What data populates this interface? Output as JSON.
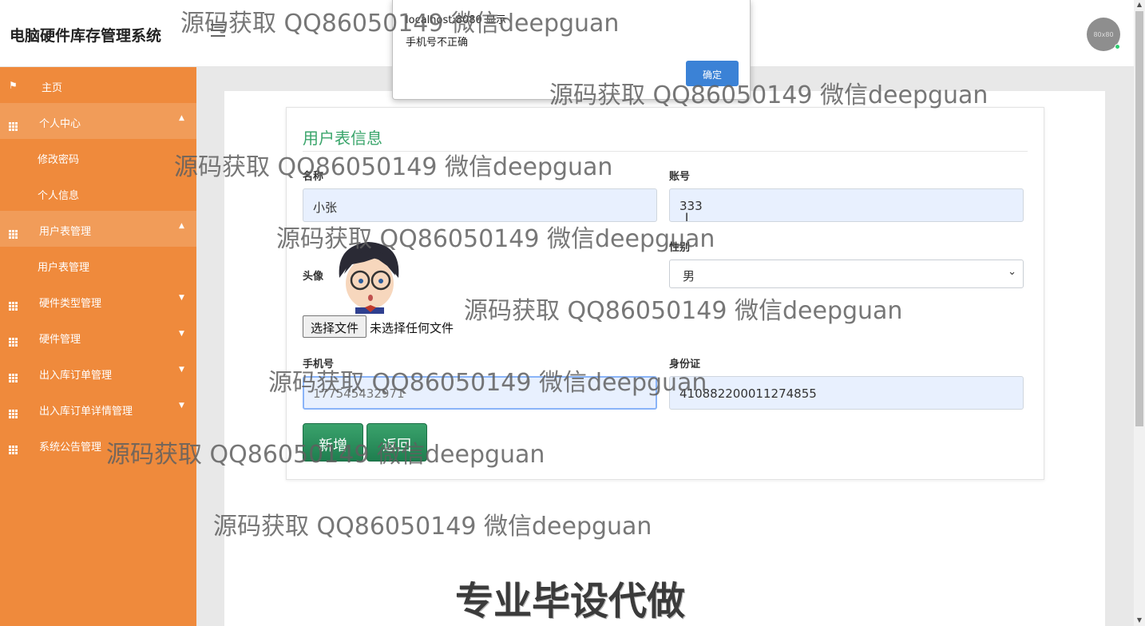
{
  "header": {
    "app_title": "电脑硬件库存管理系统",
    "avatar_label": "80x80"
  },
  "sidebar": {
    "items": [
      {
        "label": "主页",
        "icon": "flag-icon"
      },
      {
        "label": "个人中心",
        "icon": "grid-icon"
      },
      {
        "label": "修改密码"
      },
      {
        "label": "个人信息"
      },
      {
        "label": "用户表管理",
        "icon": "grid-icon"
      },
      {
        "label": "用户表管理"
      },
      {
        "label": "硬件类型管理",
        "icon": "grid-icon"
      },
      {
        "label": "硬件管理",
        "icon": "grid-icon"
      },
      {
        "label": "出入库订单管理",
        "icon": "grid-icon"
      },
      {
        "label": "出入库订单详情管理",
        "icon": "grid-icon"
      },
      {
        "label": "系统公告管理",
        "icon": "grid-icon"
      }
    ]
  },
  "form": {
    "title": "用户表信息",
    "name_label": "名称",
    "name_value": "小张",
    "account_label": "账号",
    "account_value": "333",
    "avatar_label": "头像",
    "file_button": "选择文件",
    "file_status": "未选择任何文件",
    "gender_label": "性别",
    "gender_value": "男",
    "phone_label": "手机号",
    "phone_value": "177545432971",
    "idcard_label": "身份证",
    "idcard_value": "410882200011274855",
    "add_button": "新增",
    "back_button": "返回"
  },
  "dialog": {
    "title": "localhost:8080 显示",
    "message": "手机号不正确",
    "ok_button": "确定"
  },
  "watermarks": {
    "text": "源码获取 QQ86050149 微信deepguan",
    "big": "专业毕设代做"
  },
  "colors": {
    "sidebar": "#ef8a3c",
    "sidebar_active": "#f19c59",
    "title_green": "#3aa56b",
    "button_green": "#2a9160",
    "dialog_button": "#3b82d6"
  }
}
